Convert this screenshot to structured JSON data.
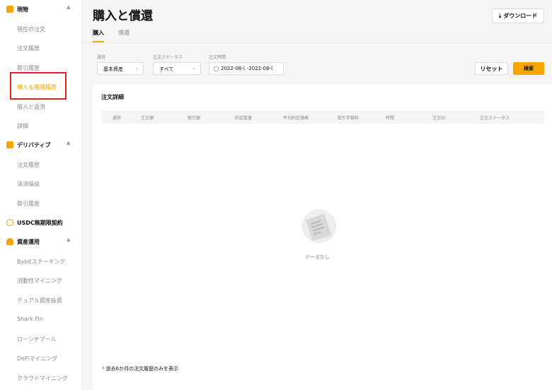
{
  "sidebar": {
    "groups": [
      {
        "label": "現物",
        "icon": "spot-icon",
        "color": "#f7a600"
      },
      {
        "label": "デリバティブ",
        "icon": "derivatives-icon",
        "color": "#f7a600"
      },
      {
        "label": "USDC無期限契約",
        "icon": "usdc-icon",
        "color": "#f7a600"
      },
      {
        "label": "資産運用",
        "icon": "earn-icon",
        "color": "#f7a600"
      }
    ],
    "spot_items": [
      "現在の注文",
      "注文履歴",
      "取引履歴",
      "購入＆償還履歴",
      "借入と返済",
      "詳細"
    ],
    "deriv_items": [
      "注文履歴",
      "決済損益",
      "取引履歴"
    ],
    "earn_items": [
      "Bybitステーキング",
      "流動性マイニング",
      "デュアル資産投資",
      "Shark Fin",
      "ローンチプール",
      "DeFiマイニング",
      "クラウドマイニング"
    ]
  },
  "header": {
    "title": "購入と償還",
    "download_label": "ダウンロード",
    "tabs": [
      "購入",
      "償還"
    ]
  },
  "filters": {
    "coin_label": "通貨",
    "coin_value": "基本資産",
    "status_label": "注文ステータス",
    "status_value": "すべて",
    "date_label": "注文時間",
    "date_value": "2022-08-( -2022-08-(",
    "reset_label": "リセット",
    "search_label": "検索"
  },
  "table": {
    "title": "注文詳細",
    "columns": [
      "通貨",
      "注文額",
      "取引額",
      "約定数量",
      "平均約定価格",
      "取引手数料",
      "時間",
      "注文ID",
      "注文ステータス"
    ],
    "empty_text": "データなし"
  },
  "footnote": {
    "star": "*",
    "text": "過去6か月の注文履歴のみを表示"
  },
  "colors": {
    "accent": "#f7a600",
    "highlight": "#e2231a"
  }
}
